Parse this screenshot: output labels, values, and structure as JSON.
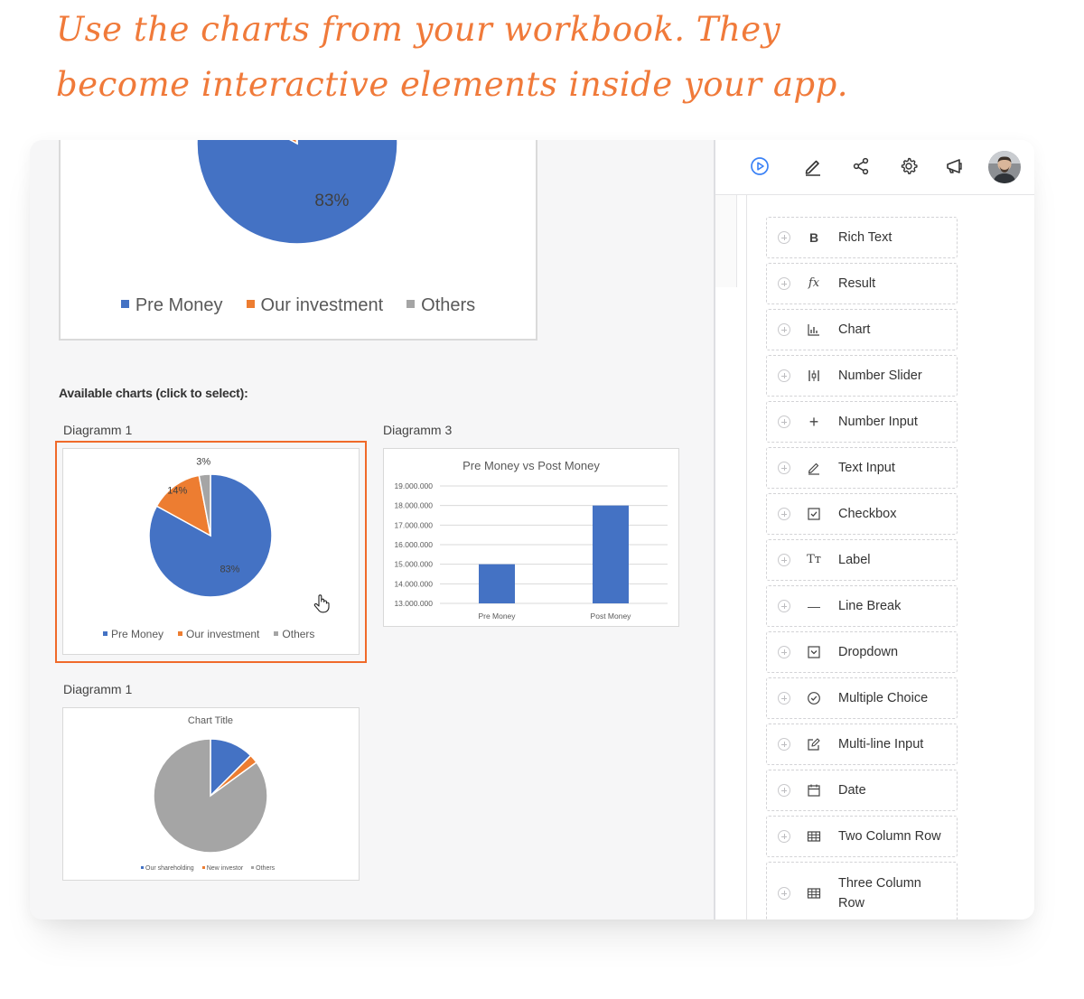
{
  "headline": {
    "line1": "Use the charts from your workbook. They",
    "line2": "become interactive elements inside your app."
  },
  "canvas": {
    "available_title": "Available charts (click to select):",
    "preview": {
      "visible_slice_label": "83%",
      "legend": [
        "Pre Money",
        "Our investment",
        "Others"
      ]
    },
    "charts": [
      {
        "label": "Diagramm 1",
        "selected": true
      },
      {
        "label": "Diagramm 3",
        "selected": false
      },
      {
        "label": "Diagramm 1",
        "selected": false
      }
    ]
  },
  "chart_data": [
    {
      "type": "pie",
      "categories": [
        "Pre Money",
        "Our investment",
        "Others"
      ],
      "values": [
        83,
        14,
        3
      ],
      "data_labels": [
        "83%",
        "14%",
        "3%"
      ],
      "colors": [
        "#4472c4",
        "#ed7d31",
        "#a5a5a5"
      ],
      "legend": "bottom"
    },
    {
      "type": "bar",
      "title": "Pre Money vs Post Money",
      "categories": [
        "Pre Money",
        "Post Money"
      ],
      "values": [
        15000000,
        18000000
      ],
      "ylim": [
        13000000,
        19000000
      ],
      "y_ticks": [
        "13.000.000",
        "14.000.000",
        "15.000.000",
        "16.000.000",
        "17.000.000",
        "18.000.000",
        "19.000.000"
      ],
      "color": "#4472c4",
      "grid": true
    },
    {
      "type": "pie",
      "title": "Chart Title",
      "categories": [
        "Our shareholding",
        "New investor",
        "Others"
      ],
      "values": [
        12.5,
        2.5,
        85
      ],
      "colors": [
        "#4472c4",
        "#ed7d31",
        "#a5a5a5"
      ],
      "legend": "bottom"
    }
  ],
  "toolbar": {
    "icons": [
      "play-icon",
      "pencil-icon",
      "share-icon",
      "gear-icon",
      "megaphone-icon",
      "avatar"
    ],
    "accent": "#3b82f6"
  },
  "widgets": [
    {
      "label": "Rich Text",
      "icon": "B",
      "icon_name": "bold-icon"
    },
    {
      "label": "Result",
      "icon": "fx",
      "icon_name": "fx-icon"
    },
    {
      "label": "Chart",
      "icon": "",
      "icon_name": "bar-chart-icon"
    },
    {
      "label": "Number Slider",
      "icon": "",
      "icon_name": "slider-icon"
    },
    {
      "label": "Number Input",
      "icon": "+",
      "icon_name": "plus-icon"
    },
    {
      "label": "Text Input",
      "icon": "",
      "icon_name": "pencil-icon"
    },
    {
      "label": "Checkbox",
      "icon": "",
      "icon_name": "checkbox-icon"
    },
    {
      "label": "Label",
      "icon": "Tт",
      "icon_name": "text-size-icon"
    },
    {
      "label": "Line Break",
      "icon": "—",
      "icon_name": "line-break-icon"
    },
    {
      "label": "Dropdown",
      "icon": "",
      "icon_name": "dropdown-icon"
    },
    {
      "label": "Multiple Choice",
      "icon": "",
      "icon_name": "check-circle-icon"
    },
    {
      "label": "Multi-line Input",
      "icon": "",
      "icon_name": "edit-box-icon"
    },
    {
      "label": "Date",
      "icon": "",
      "icon_name": "calendar-icon"
    },
    {
      "label": "Two Column Row",
      "icon": "",
      "icon_name": "grid-icon"
    },
    {
      "label": "Three Column Row",
      "icon": "",
      "icon_name": "grid-icon"
    }
  ]
}
